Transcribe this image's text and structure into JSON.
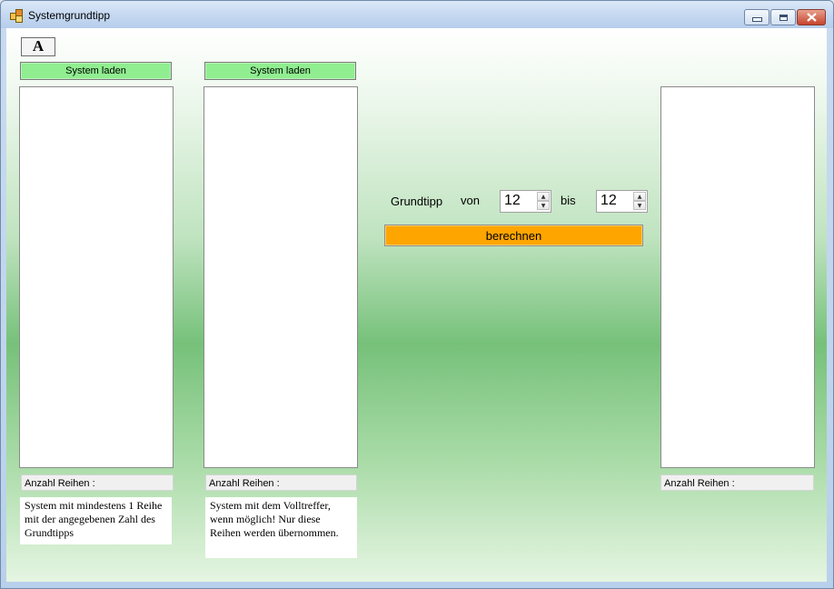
{
  "window": {
    "title": "Systemgrundtipp"
  },
  "toolbar": {
    "font_button": "A"
  },
  "left_panel": {
    "load_label": "System laden",
    "count_label": "Anzahl Reihen :",
    "description": "System mit mindestens 1 Reihe mit der angegebenen Zahl des Grundtipps"
  },
  "middle_panel": {
    "load_label": "System laden",
    "count_label": "Anzahl Reihen :",
    "description": "System mit dem Volltreffer, wenn möglich! Nur diese Reihen werden übernommen."
  },
  "controls": {
    "grundtipp_label": "Grundtipp",
    "von_label": "von",
    "von_value": "12",
    "bis_label": "bis",
    "bis_value": "12",
    "calculate_label": "berechnen"
  },
  "right_panel": {
    "count_label": "Anzahl Reihen :"
  },
  "colors": {
    "load_button": "#90ee90",
    "calculate_button": "#ffa500"
  },
  "icons": [
    "app-icon",
    "minimize-icon",
    "maximize-icon",
    "close-icon",
    "font-icon",
    "spin-up-icon",
    "spin-down-icon"
  ]
}
